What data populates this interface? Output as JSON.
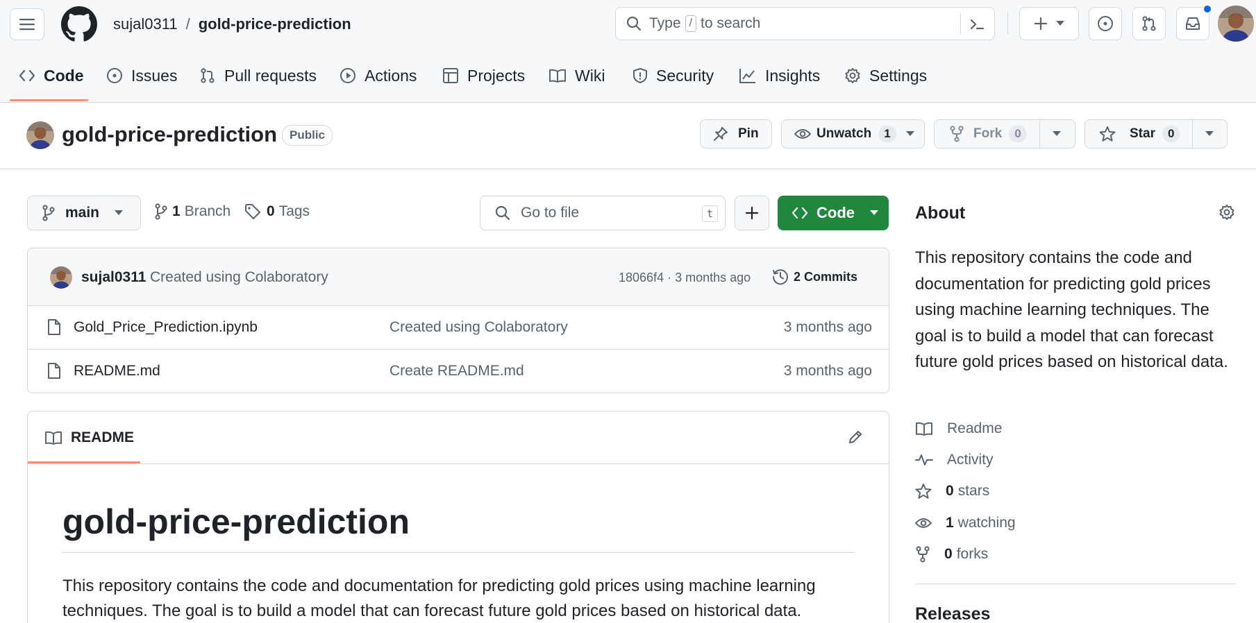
{
  "header": {
    "owner": "sujal0311",
    "separator": "/",
    "repo": "gold-price-prediction",
    "search_prefix": "Type",
    "search_key": "/",
    "search_suffix": "to search"
  },
  "tabs": [
    {
      "label": "Code",
      "icon": "code-icon"
    },
    {
      "label": "Issues",
      "icon": "issue-icon"
    },
    {
      "label": "Pull requests",
      "icon": "pull-request-icon"
    },
    {
      "label": "Actions",
      "icon": "play-icon"
    },
    {
      "label": "Projects",
      "icon": "table-icon"
    },
    {
      "label": "Wiki",
      "icon": "book-icon"
    },
    {
      "label": "Security",
      "icon": "shield-icon"
    },
    {
      "label": "Insights",
      "icon": "graph-icon"
    },
    {
      "label": "Settings",
      "icon": "gear-icon"
    }
  ],
  "repo_header": {
    "name": "gold-price-prediction",
    "visibility": "Public",
    "pin_label": "Pin",
    "unwatch_label": "Unwatch",
    "watch_count": "1",
    "fork_label": "Fork",
    "fork_count": "0",
    "star_label": "Star",
    "star_count": "0"
  },
  "toolbar": {
    "branch": "main",
    "branch_count": "1",
    "branch_label": "Branch",
    "tag_count": "0",
    "tag_label": "Tags",
    "goto_placeholder": "Go to file",
    "goto_key": "t",
    "code_label": "Code"
  },
  "commit": {
    "author": "sujal0311",
    "message": "Created using Colaboratory",
    "sha": "18066f4",
    "dot": "·",
    "time": "3 months ago",
    "commits_count": "2",
    "commits_label": "Commits"
  },
  "files": [
    {
      "name": "Gold_Price_Prediction.ipynb",
      "message": "Created using Colaboratory",
      "time": "3 months ago"
    },
    {
      "name": "README.md",
      "message": "Create README.md",
      "time": "3 months ago"
    }
  ],
  "readme": {
    "tab_label": "README",
    "title": "gold-price-prediction",
    "body": "This repository contains the code and documentation for predicting gold prices using machine learning techniques. The goal is to build a model that can forecast future gold prices based on historical data."
  },
  "about": {
    "title": "About",
    "description": "This repository contains the code and documentation for predicting gold prices using machine learning techniques. The goal is to build a model that can forecast future gold prices based on historical data.",
    "readme_label": "Readme",
    "activity_label": "Activity",
    "stars_count": "0",
    "stars_label": "stars",
    "watching_count": "1",
    "watching_label": "watching",
    "forks_count": "0",
    "forks_label": "forks",
    "releases_title": "Releases"
  },
  "colors": {
    "accent_green": "#1f883d",
    "tab_underline": "#fd8c73",
    "notification_dot": "#0969da",
    "border": "#d1d9e0"
  }
}
